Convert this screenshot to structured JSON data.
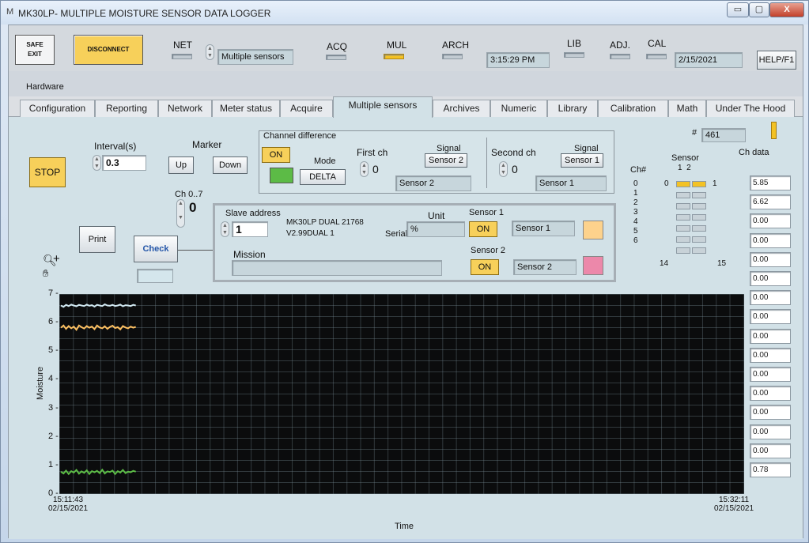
{
  "window": {
    "icon_glyph": "M",
    "title": "MK30LP- MULTIPLE MOISTURE SENSOR DATA LOGGER",
    "minimize_glyph": "▭",
    "maximize_glyph": "▢",
    "close_glyph": "X"
  },
  "toolbar": {
    "safe_exit_label": "SAFE\nEXIT",
    "disconnect_label": "DISCONNECT",
    "net_label": "NET",
    "mode_value": "Multiple sensors",
    "acq_label": "ACQ",
    "mul_label": "MUL",
    "arch_label": "ARCH",
    "time_value": "3:15:29 PM",
    "lib_label": "LIB",
    "adj_label": "ADJ.",
    "cal_label": "CAL",
    "date_value": "2/15/2021",
    "help_label": "HELP/F1",
    "mul_led": "on"
  },
  "hardware_label": "Hardware",
  "tabs": [
    {
      "label": "Configuration"
    },
    {
      "label": "Reporting"
    },
    {
      "label": "Network"
    },
    {
      "label": "Meter status"
    },
    {
      "label": "Acquire"
    },
    {
      "label": "Multiple sensors",
      "active": true
    },
    {
      "label": "Archives"
    },
    {
      "label": "Numeric"
    },
    {
      "label": "Library"
    },
    {
      "label": "Calibration"
    },
    {
      "label": "Math"
    },
    {
      "label": "Under The Hood"
    }
  ],
  "controls": {
    "stop_label": "STOP",
    "interval_label": "Interval(s)",
    "interval_value": "0.3",
    "marker_label": "Marker",
    "up_label": "Up",
    "down_label": "Down",
    "ch07_label": "Ch 0..7",
    "ch07_value": "0",
    "print_label": "Print",
    "check_label": "Check",
    "zoom_icon_glyph": "🔍︎",
    "crosshair_glyph": "+",
    "hand_icon_glyph": "✋︎"
  },
  "channel_difference": {
    "title": "Channel difference",
    "on_label": "ON",
    "mode_label": "Mode",
    "mode_value": "DELTA",
    "first_ch_label": "First ch",
    "first_ch_value": "0",
    "signal1_label": "Signal",
    "signal1_button": "Sensor 2",
    "signal1_field": "Sensor 2",
    "second_ch_label": "Second ch",
    "second_ch_value": "0",
    "signal2_label": "Signal",
    "signal2_button": "Sensor 1",
    "signal2_field": "Sensor 1",
    "delta_color": "#5cbb46"
  },
  "slave": {
    "address_label": "Slave address",
    "address_value": "1",
    "model": "MK30LP DUAL 21768",
    "version": "V2.99DUAL 1",
    "serial_label": "Serial",
    "unit_label": "Unit",
    "unit_value": "%",
    "mission_label": "Mission",
    "mission_value": "",
    "sensor1_label": "Sensor 1",
    "sensor1_on": "ON",
    "sensor1_name": "Sensor 1",
    "sensor1_color": "#fdd28c",
    "sensor2_label": "Sensor 2",
    "sensor2_on": "ON",
    "sensor2_name": "Sensor 2",
    "sensor2_color": "#ec88aa"
  },
  "sensor_grid": {
    "hash_label": "#",
    "count_value": "461",
    "sensor_label": "Sensor",
    "col_labels": "1  2",
    "ch_header": "Ch#",
    "rows": [
      "0",
      "1",
      "2",
      "3",
      "4",
      "5",
      "6"
    ],
    "label_0": "0",
    "label_1": "1",
    "label_14": "14",
    "label_15": "15"
  },
  "ch_data": {
    "header": "Ch data",
    "values": [
      "5.85",
      "6.62",
      "0.00",
      "0.00",
      "0.00",
      "0.00",
      "0.00",
      "0.00",
      "0.00",
      "0.00",
      "0.00",
      "0.00",
      "0.00",
      "0.00",
      "0.00",
      "0.78"
    ]
  },
  "chart_data": {
    "type": "line",
    "ylabel": "Moisture",
    "xlabel": "Time",
    "ylim": [
      0,
      7
    ],
    "yticks": [
      "0",
      "1",
      "2",
      "3",
      "4",
      "5",
      "6",
      "7"
    ],
    "x_start": "15:11:43\n02/15/2021",
    "x_end": "15:32:11\n02/15/2021",
    "grid": true,
    "series": [
      {
        "color": "#cfe7f0",
        "values": [
          6.6,
          6.55,
          6.62,
          6.58,
          6.63,
          6.6,
          6.57,
          6.62,
          6.6,
          6.58,
          6.63,
          6.59,
          6.61,
          6.56,
          6.62,
          6.6,
          6.58,
          6.64,
          6.6,
          6.59,
          6.62,
          6.58,
          6.6,
          6.63,
          6.57,
          6.61,
          6.6,
          6.58,
          6.62,
          6.6
        ]
      },
      {
        "color": "#fdc062",
        "values": [
          5.82,
          5.9,
          5.78,
          5.88,
          5.8,
          5.86,
          5.75,
          5.9,
          5.84,
          5.79,
          5.88,
          5.82,
          5.86,
          5.77,
          5.9,
          5.83,
          5.8,
          5.87,
          5.78,
          5.85,
          5.89,
          5.81,
          5.84,
          5.76,
          5.88,
          5.83,
          5.8,
          5.86,
          5.82,
          5.85
        ]
      },
      {
        "color": "#5cbb46",
        "values": [
          0.78,
          0.72,
          0.82,
          0.7,
          0.8,
          0.75,
          0.84,
          0.71,
          0.79,
          0.74,
          0.83,
          0.7,
          0.8,
          0.76,
          0.81,
          0.73,
          0.85,
          0.72,
          0.79,
          0.77,
          0.82,
          0.7,
          0.8,
          0.75,
          0.84,
          0.73,
          0.78,
          0.76,
          0.81,
          0.78
        ]
      }
    ],
    "fraction_of_window": 0.114
  }
}
